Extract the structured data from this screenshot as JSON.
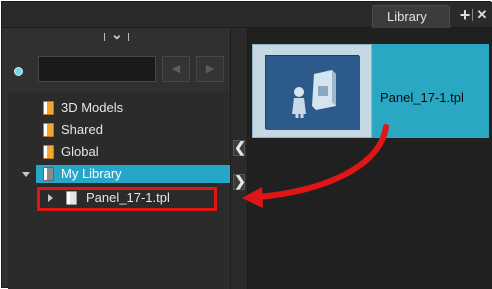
{
  "panel": {
    "tab_title": "Library",
    "add_symbol": "+",
    "close_symbol": "✕"
  },
  "search": {
    "value": "",
    "placeholder": ""
  },
  "nav": {
    "back_symbol": "◀",
    "forward_symbol": "▶"
  },
  "tree": {
    "items": [
      {
        "label": "3D Models"
      },
      {
        "label": "Shared"
      },
      {
        "label": "Global"
      },
      {
        "label": "My Library"
      },
      {
        "label": "Panel_17-1.tpl"
      }
    ]
  },
  "splitter": {
    "collapse_left": "❮",
    "expand_right": "❯"
  },
  "content": {
    "tile_label": "Panel_17-1.tpl"
  },
  "colors": {
    "selection": "#27a7c7",
    "callout": "#e01616"
  }
}
